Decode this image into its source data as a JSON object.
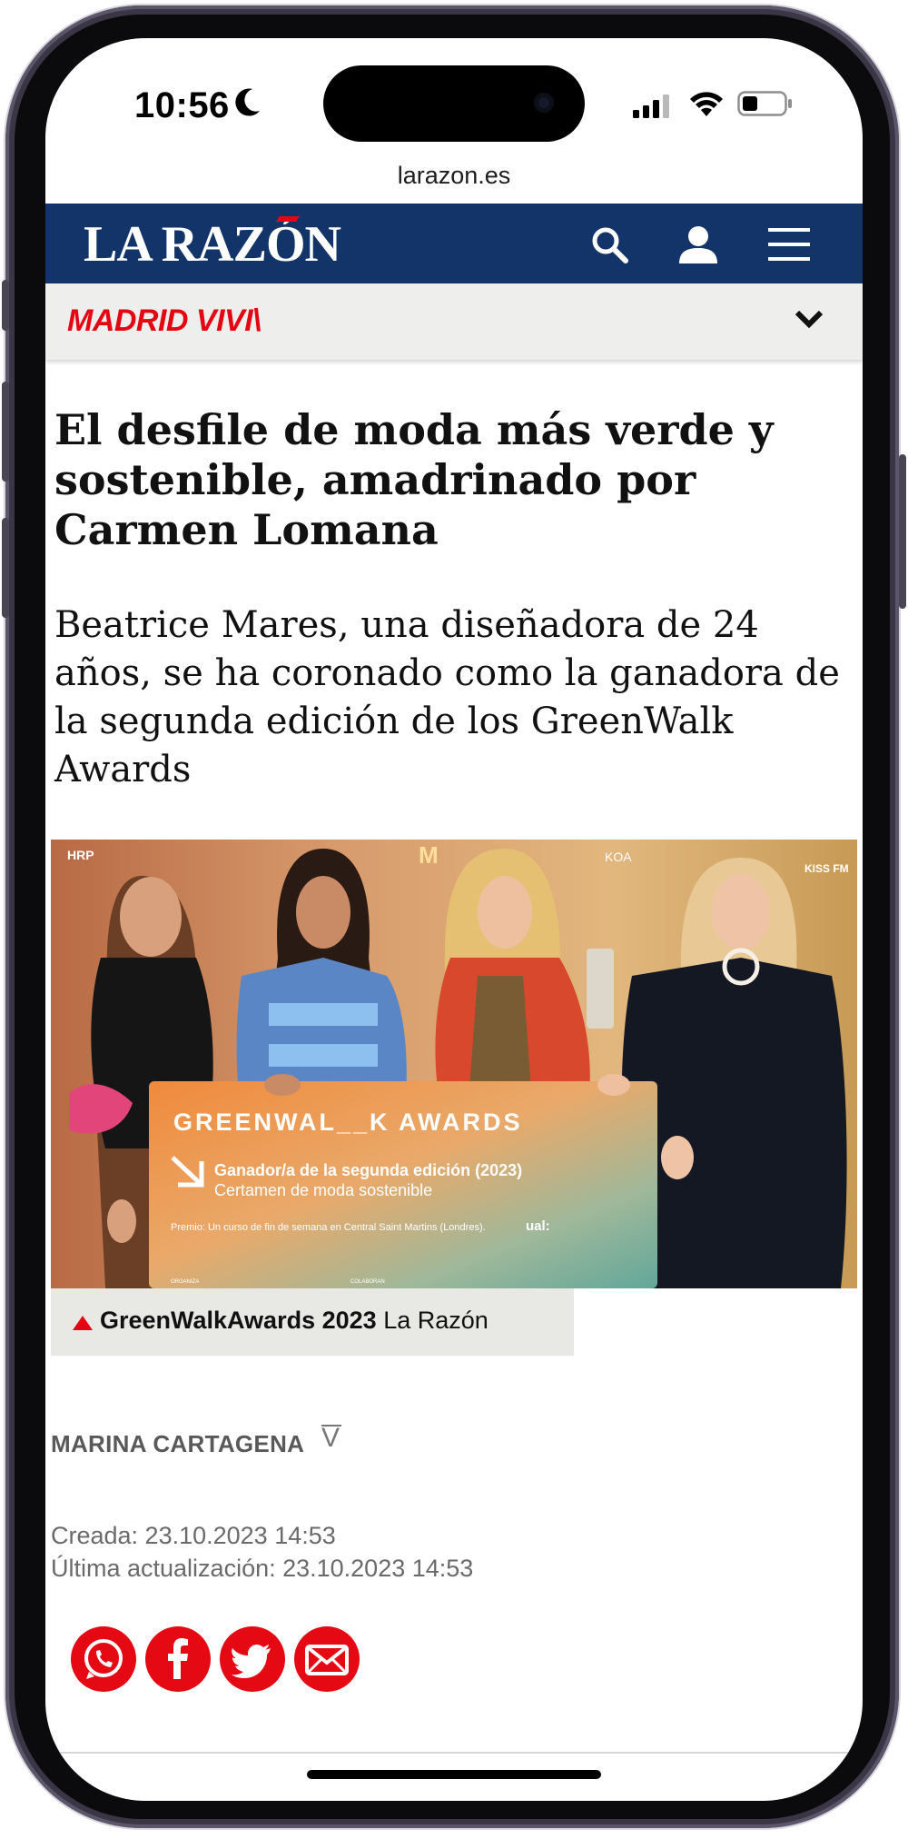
{
  "status_bar": {
    "time": "10:56",
    "icons": [
      "moon-icon",
      "cellular-signal-icon",
      "wifi-icon",
      "battery-icon"
    ]
  },
  "browser": {
    "url": "larazon.es"
  },
  "site": {
    "logo": "LA RAZÓN",
    "header_icons": [
      "search-icon",
      "user-icon",
      "menu-icon"
    ],
    "section": "MADRID VIVI\\",
    "colors": {
      "header_bg": "#133468",
      "accent": "#e30613",
      "section_bg": "#eeeeec"
    }
  },
  "article": {
    "headline": "El desfile de moda más verde y sostenible, amadrinado por Carmen Lomana",
    "subtitle": "Beatrice Mares, una diseñadora de 24 años, se ha coronado como la ganadora de la segunda edición de los GreenWalk Awards",
    "image": {
      "sign_brand": "GREENWAL__K AWARDS",
      "sign_line1": "Ganador/a de la segunda edición (2023)",
      "sign_line2": "Certamen de moda sostenible",
      "sign_prize": "Premio: Un curso de fin de semana en Central Saint Martins (Londres).",
      "sign_sponsor": "ual:",
      "sign_org_label": "ORGANIZA",
      "sign_collab_label": "COLABORAN",
      "backdrop_logos": [
        "HRP",
        "KOA",
        "KISS FM"
      ]
    },
    "caption_title": "GreenWalkAwards 2023",
    "caption_source": "La Razón",
    "author": "MARINA CARTAGENA",
    "author_mark": "V",
    "created": "Creada: 23.10.2023 14:53",
    "updated": "Última actualización: 23.10.2023 14:53",
    "share_buttons": [
      "whatsapp-icon",
      "facebook-icon",
      "twitter-icon",
      "email-icon"
    ]
  }
}
